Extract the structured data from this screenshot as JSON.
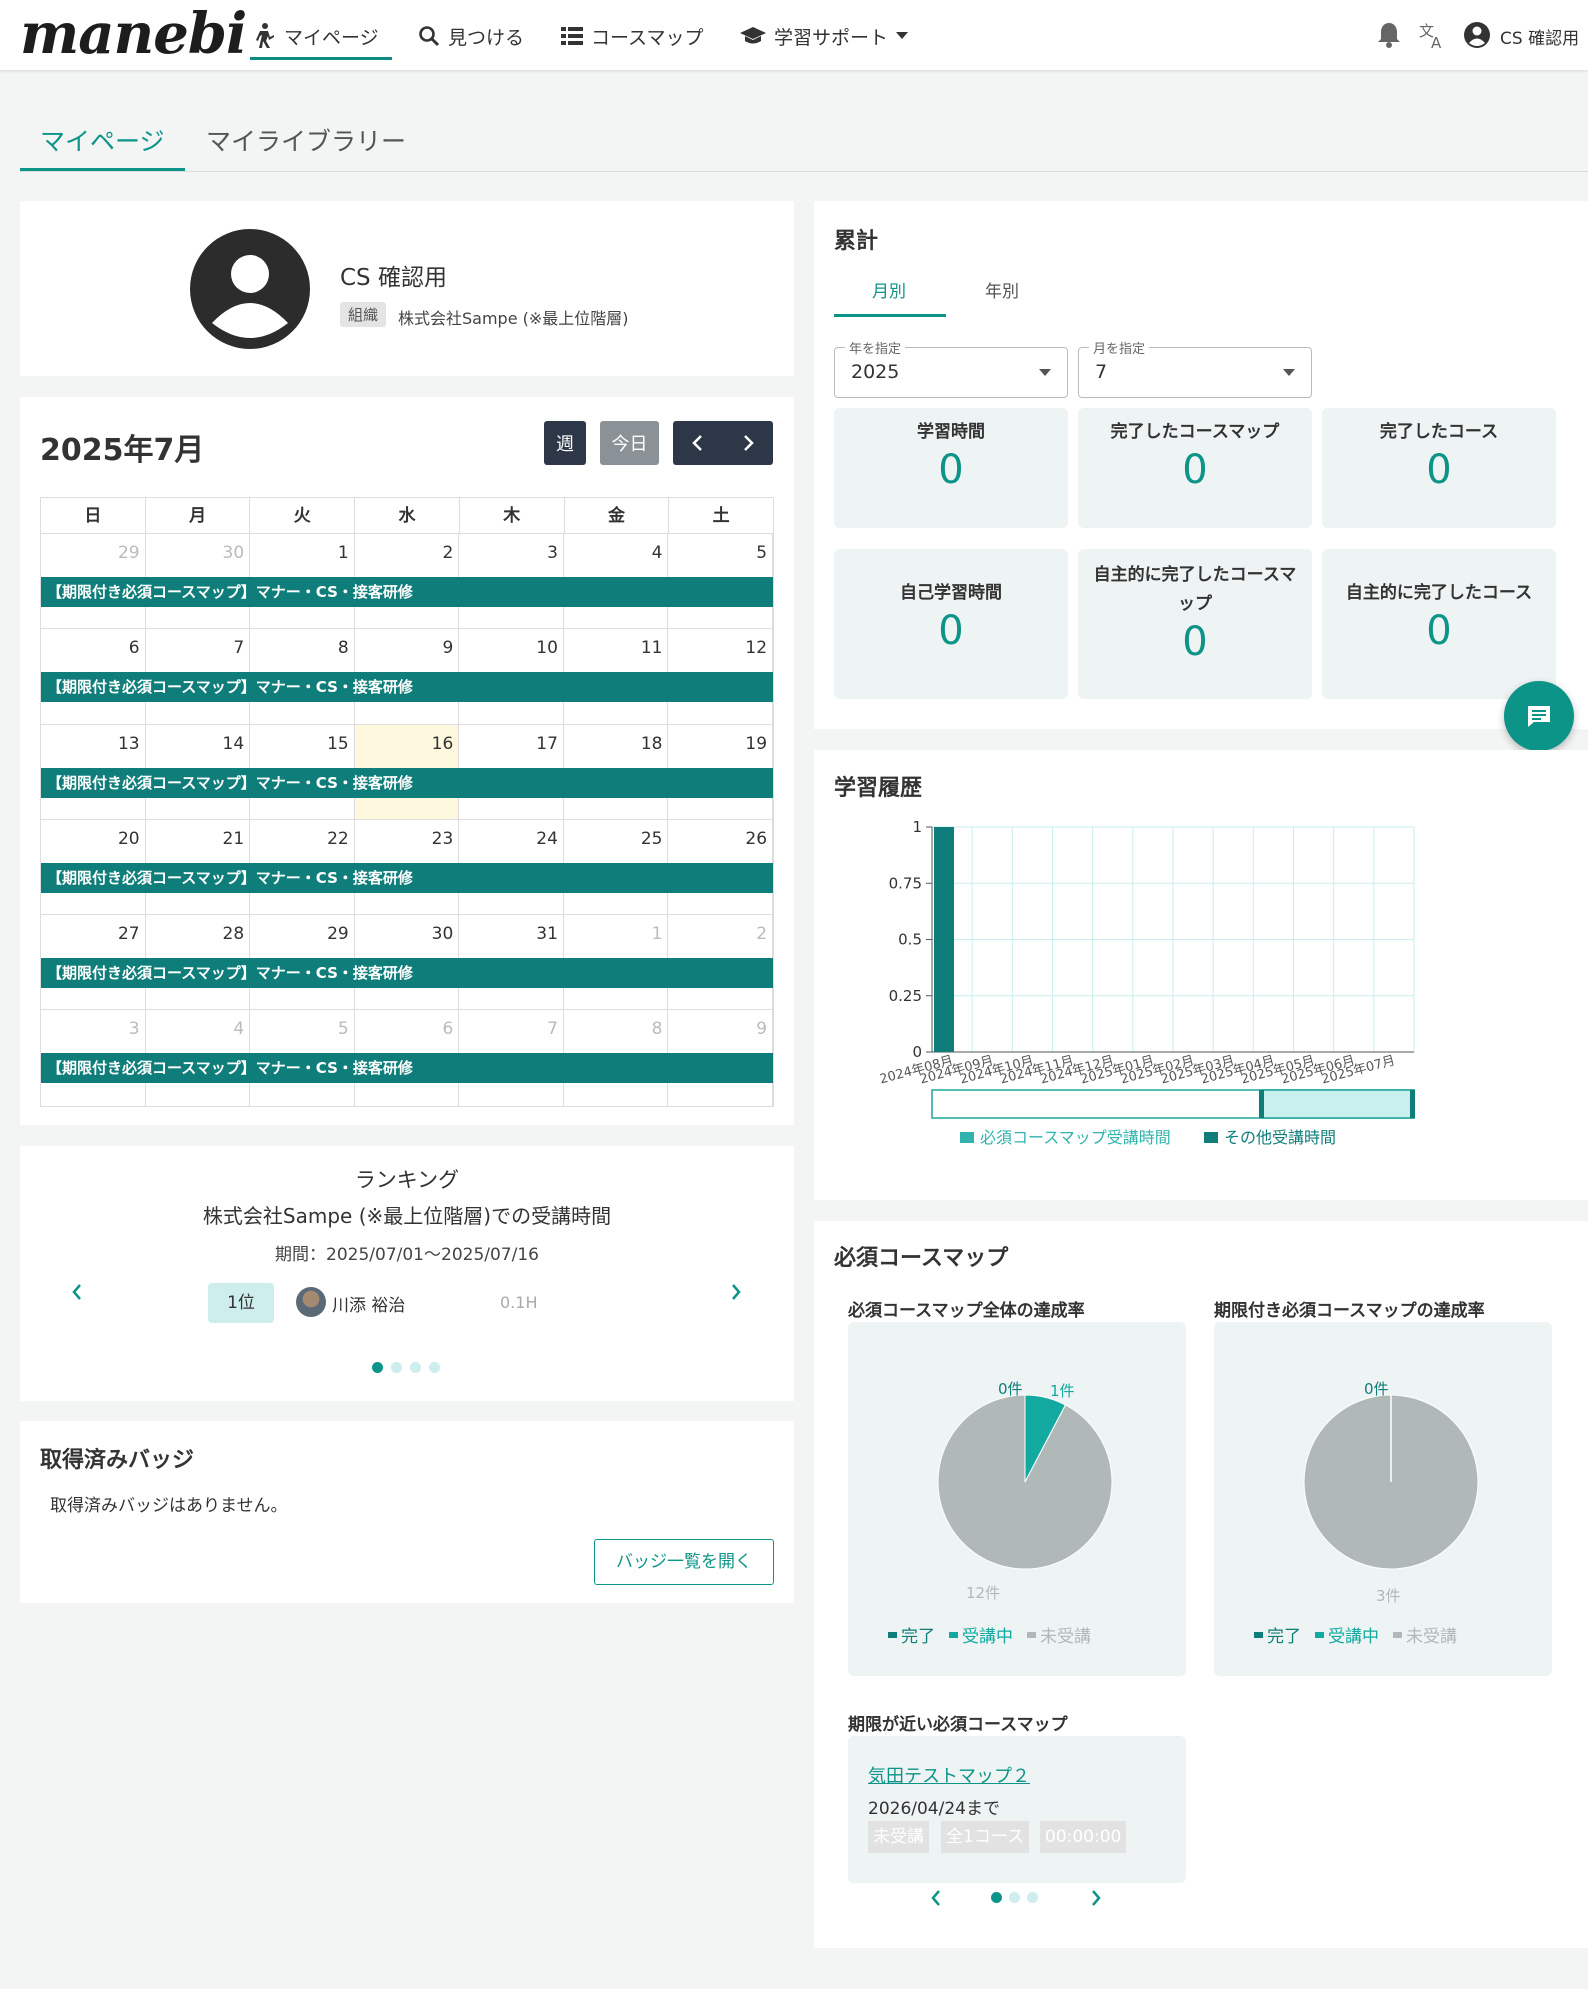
{
  "header": {
    "logo": "manebi",
    "nav": [
      {
        "label": "マイページ",
        "active": true
      },
      {
        "label": "見つける"
      },
      {
        "label": "コースマップ"
      },
      {
        "label": "学習サポート"
      }
    ],
    "user": "CS 確認用"
  },
  "page_tabs": [
    "マイページ",
    "マイライブラリー"
  ],
  "profile": {
    "name": "CS 確認用",
    "org_badge": "組織",
    "org_name": "株式会社Sampe (※最上位階層)"
  },
  "calendar": {
    "title": "2025年7月",
    "week_btn": "週",
    "today_btn": "今日",
    "weekdays": [
      "日",
      "月",
      "火",
      "水",
      "木",
      "金",
      "土"
    ],
    "event": "【期限付き必須コースマップ】マナー・CS・接客研修",
    "weeks": [
      [
        [
          "29",
          true
        ],
        [
          "30",
          true
        ],
        [
          "1"
        ],
        [
          "2"
        ],
        [
          "3"
        ],
        [
          "4"
        ],
        [
          "5"
        ]
      ],
      [
        [
          "6"
        ],
        [
          "7"
        ],
        [
          "8"
        ],
        [
          "9"
        ],
        [
          "10"
        ],
        [
          "11"
        ],
        [
          "12"
        ]
      ],
      [
        [
          "13"
        ],
        [
          "14"
        ],
        [
          "15"
        ],
        [
          "16",
          false,
          true
        ],
        [
          "17"
        ],
        [
          "18"
        ],
        [
          "19"
        ]
      ],
      [
        [
          "20"
        ],
        [
          "21"
        ],
        [
          "22"
        ],
        [
          "23"
        ],
        [
          "24"
        ],
        [
          "25"
        ],
        [
          "26"
        ]
      ],
      [
        [
          "27"
        ],
        [
          "28"
        ],
        [
          "29"
        ],
        [
          "30"
        ],
        [
          "31"
        ],
        [
          "1",
          true
        ],
        [
          "2",
          true
        ]
      ],
      [
        [
          "3",
          true
        ],
        [
          "4",
          true
        ],
        [
          "5",
          true
        ],
        [
          "6",
          true
        ],
        [
          "7",
          true
        ],
        [
          "8",
          true
        ],
        [
          "9",
          true
        ]
      ]
    ]
  },
  "ranking": {
    "title": "ランキング",
    "subtitle": "株式会社Sampe (※最上位階層)での受講時間",
    "period": "期間：2025/07/01〜2025/07/16",
    "position": "1位",
    "name": "川添 裕治",
    "hours": "0.1H"
  },
  "badges": {
    "title": "取得済みバッジ",
    "empty": "取得済みバッジはありません。",
    "button": "バッジ一覧を開く"
  },
  "totals": {
    "title": "累計",
    "tabs": [
      "月別",
      "年別"
    ],
    "year_label": "年を指定",
    "year_value": "2025",
    "month_label": "月を指定",
    "month_value": "7",
    "stats": [
      {
        "label": "学習時間",
        "value": "0"
      },
      {
        "label": "完了したコースマップ",
        "value": "0"
      },
      {
        "label": "完了したコース",
        "value": "0"
      },
      {
        "label": "自己学習時間",
        "value": "0"
      },
      {
        "label": "自主的に完了したコースマップ",
        "value": "0"
      },
      {
        "label": "自主的に完了したコース",
        "value": "0"
      }
    ]
  },
  "history": {
    "title": "学習履歴",
    "chart_data": {
      "type": "bar",
      "title": "学習履歴",
      "categories": [
        "2024年08月",
        "2024年09月",
        "2024年10月",
        "2024年11月",
        "2024年12月",
        "2025年01月",
        "2025年02月",
        "2025年03月",
        "2025年04月",
        "2025年05月",
        "2025年06月",
        "2025年07月"
      ],
      "series": [
        {
          "name": "必須コースマップ受講時間",
          "color": "#2fb3ac",
          "values": [
            0,
            0,
            0,
            0,
            0,
            0,
            0,
            0,
            0,
            0,
            0,
            0
          ]
        },
        {
          "name": "その他受講時間",
          "color": "#0f7e7a",
          "values": [
            1,
            0,
            0,
            0,
            0,
            0,
            0,
            0,
            0,
            0,
            0,
            0
          ]
        }
      ],
      "yticks": [
        "0",
        "0.25",
        "0.5",
        "0.75",
        "1"
      ],
      "ylim": [
        0,
        1
      ]
    }
  },
  "required": {
    "title": "必須コースマップ",
    "pies": [
      {
        "title": "必須コースマップ全体の達成率",
        "chart_data": {
          "type": "pie",
          "slices": [
            {
              "label": "完了",
              "value": 0,
              "text": "0件",
              "color": "#0f7e7a"
            },
            {
              "label": "受講中",
              "value": 1,
              "text": "1件",
              "color": "#11a9a0"
            },
            {
              "label": "未受講",
              "value": 12,
              "text": "12件",
              "color": "#b1b9b8"
            }
          ]
        }
      },
      {
        "title": "期限付き必須コースマップの達成率",
        "chart_data": {
          "type": "pie",
          "slices": [
            {
              "label": "完了",
              "value": 0,
              "text": "0件",
              "color": "#0f7e7a"
            },
            {
              "label": "受講中",
              "value": 0,
              "text": "0件",
              "color": "#11a9a0"
            },
            {
              "label": "未受講",
              "value": 3,
              "text": "3件",
              "color": "#b1b9b8"
            }
          ]
        }
      }
    ],
    "legend": [
      "完了",
      "受講中",
      "未受講"
    ],
    "near_title": "期限が近い必須コースマップ",
    "near": {
      "name": "気田テストマップ２",
      "date": "2026/04/24まで",
      "tags": [
        "未受講",
        "全1コース",
        "00:00:00"
      ]
    }
  }
}
